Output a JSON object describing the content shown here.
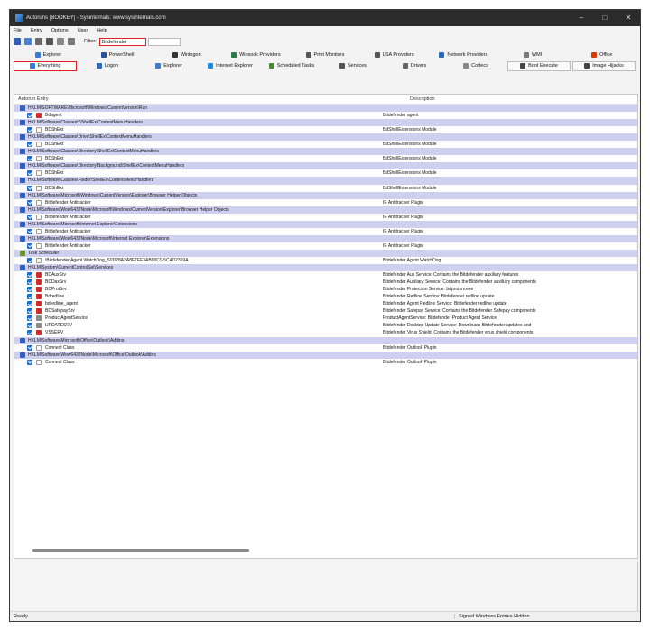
{
  "window": {
    "title": "Autoruns [BOOKEY] - Sysinternals: www.sysinternals.com"
  },
  "menu": [
    "File",
    "Entry",
    "Options",
    "User",
    "Help"
  ],
  "filter": {
    "label": "Filter:",
    "value": "Bitdefender"
  },
  "tabs_row1": [
    {
      "label": "Explorer",
      "icon_color": "#3a7bd5"
    },
    {
      "label": "PowerShell",
      "icon_color": "#2b4f9a"
    },
    {
      "label": "Winlogon",
      "icon_color": "#333333"
    },
    {
      "label": "Winsock Providers",
      "icon_color": "#2a7a4a"
    },
    {
      "label": "Print Monitors",
      "icon_color": "#555555"
    },
    {
      "label": "LSA Providers",
      "icon_color": "#555555"
    },
    {
      "label": "Network Providers",
      "icon_color": "#2a6ac0"
    },
    {
      "label": "WMI",
      "icon_color": "#777777"
    },
    {
      "label": "Office",
      "icon_color": "#d83b01"
    }
  ],
  "tabs_row2": [
    {
      "label": "Everything",
      "icon_color": "#3a7bd5",
      "active": true
    },
    {
      "label": "Logon",
      "icon_color": "#2a6ac0"
    },
    {
      "label": "Explorer",
      "icon_color": "#3a7bd5"
    },
    {
      "label": "Internet Explorer",
      "icon_color": "#1e88e5"
    },
    {
      "label": "Scheduled Tasks",
      "icon_color": "#4a8a2a"
    },
    {
      "label": "Services",
      "icon_color": "#555555"
    },
    {
      "label": "Drivers",
      "icon_color": "#666666"
    },
    {
      "label": "Codecs",
      "icon_color": "#888888"
    },
    {
      "label": "Boot Execute",
      "icon_color": "#444444",
      "bordered": true
    },
    {
      "label": "Image Hijacks",
      "icon_color": "#444444",
      "bordered": true
    }
  ],
  "columns": {
    "entry": "Autorun Entry",
    "description": "Description"
  },
  "rows": [
    {
      "type": "key",
      "text": "HKLM\\SOFTWARE\\Microsoft\\Windows\\CurrentVersion\\Run"
    },
    {
      "type": "entry",
      "icon": "red",
      "name": "Bdagent",
      "desc": "Bitdefender agent"
    },
    {
      "type": "key",
      "text": "HKLM\\Software\\Classes\\*\\ShellEx\\ContextMenuHandlers"
    },
    {
      "type": "entry",
      "icon": "gen",
      "name": "BDShExt",
      "desc": "BdShellExtensions Module"
    },
    {
      "type": "key",
      "text": "HKLM\\Software\\Classes\\Drive\\ShellEx\\ContextMenuHandlers"
    },
    {
      "type": "entry",
      "icon": "gen",
      "name": "BDShExt",
      "desc": "BdShellExtensions Module"
    },
    {
      "type": "key",
      "text": "HKLM\\Software\\Classes\\Directory\\ShellEx\\ContextMenuHandlers"
    },
    {
      "type": "entry",
      "icon": "gen",
      "name": "BDShExt",
      "desc": "BdShellExtensions Module"
    },
    {
      "type": "key",
      "text": "HKLM\\Software\\Classes\\Directory\\Background\\ShellEx\\ContextMenuHandlers"
    },
    {
      "type": "entry",
      "icon": "gen",
      "name": "BDShExt",
      "desc": "BdShellExtensions Module"
    },
    {
      "type": "key",
      "text": "HKLM\\Software\\Classes\\Folder\\ShellEx\\ContextMenuHandlers"
    },
    {
      "type": "entry",
      "icon": "gen",
      "name": "BDShExt",
      "desc": "BdShellExtensions Module"
    },
    {
      "type": "key",
      "text": "HKLM\\Software\\Microsoft\\Windows\\CurrentVersion\\Explorer\\Browser Helper Objects"
    },
    {
      "type": "entry",
      "icon": "gen",
      "name": "Bitdefender Antitracker",
      "desc": "IE Antitracker Plugin"
    },
    {
      "type": "key",
      "text": "HKLM\\Software\\Wow6432Node\\Microsoft\\Windows\\CurrentVersion\\Explorer\\Browser Helper Objects"
    },
    {
      "type": "entry",
      "icon": "gen",
      "name": "Bitdefender Antitracker",
      "desc": "IE Antitracker Plugin"
    },
    {
      "type": "key",
      "text": "HKLM\\Software\\Microsoft\\Internet Explorer\\Extensions"
    },
    {
      "type": "entry",
      "icon": "gen",
      "name": "Bitdefender Antitracker",
      "desc": "IE Antitracker Plugin"
    },
    {
      "type": "key",
      "text": "HKLM\\Software\\Wow6432Node\\Microsoft\\Internet Explorer\\Extensions"
    },
    {
      "type": "entry",
      "icon": "gen",
      "name": "Bitdefender Antitracker",
      "desc": "IE Antitracker Plugin"
    },
    {
      "type": "key",
      "text": "Task Scheduler",
      "task": true
    },
    {
      "type": "entry",
      "icon": "gen",
      "name": "\\Bitdefender Agent WatchDog_S0D28A2A8F7EF3AB90C0-5C4D2369A",
      "desc": "Bitdefender Agent WatchDog"
    },
    {
      "type": "key",
      "text": "HKLM\\System\\CurrentControlSet\\Services"
    },
    {
      "type": "entry",
      "icon": "red",
      "name": "BDAuxSrv",
      "desc": "Bitdefender Aux Service: Contains the Bitdefender auxiliary features"
    },
    {
      "type": "entry",
      "icon": "red",
      "name": "BDDaxSrv",
      "desc": "Bitdefender Auxiliary Service: Contains the Bitdefender auxiliary components"
    },
    {
      "type": "entry",
      "icon": "red",
      "name": "BDProtSrv",
      "desc": "Bitdefender Protection Service: bdprotsrv.exe"
    },
    {
      "type": "entry",
      "icon": "red",
      "name": "Bdredline",
      "desc": "Bitdefender Redline Service: Bitdefender redline update"
    },
    {
      "type": "entry",
      "icon": "red",
      "name": "bdredline_agent",
      "desc": "Bitdefender Agent Redline Service: Bitdefender redline update"
    },
    {
      "type": "entry",
      "icon": "red",
      "name": "BDSafepaySrv",
      "desc": "Bitdefender Safepay Service: Contains the Bitdefender Safepay components"
    },
    {
      "type": "entry",
      "icon": "gray",
      "name": "ProductAgentService",
      "desc": "ProductAgentService: Bitdefender Product Agent Service"
    },
    {
      "type": "entry",
      "icon": "gray",
      "name": "UPDATESRV",
      "desc": "Bitdefender Desktop Update Service: Downloads Bitdefender updates and"
    },
    {
      "type": "entry",
      "icon": "red",
      "name": "VSSERV",
      "desc": "Bitdefender Virus Shield: Contains the Bitdefender virus shield components"
    },
    {
      "type": "key",
      "text": "HKLM\\Software\\Microsoft\\Office\\Outlook\\Addins"
    },
    {
      "type": "entry",
      "icon": "gen",
      "name": "Connect Class",
      "desc": "Bitdefender Outlook Plugin"
    },
    {
      "type": "key",
      "text": "HKLM\\Software\\Wow6432Node\\Microsoft\\Office\\Outlook\\Addins"
    },
    {
      "type": "entry",
      "icon": "gen",
      "name": "Connect Class",
      "desc": "Bitdefender Outlook Plugin"
    }
  ],
  "status": {
    "left": "Ready.",
    "right": "Signed Windows Entries Hidden."
  }
}
